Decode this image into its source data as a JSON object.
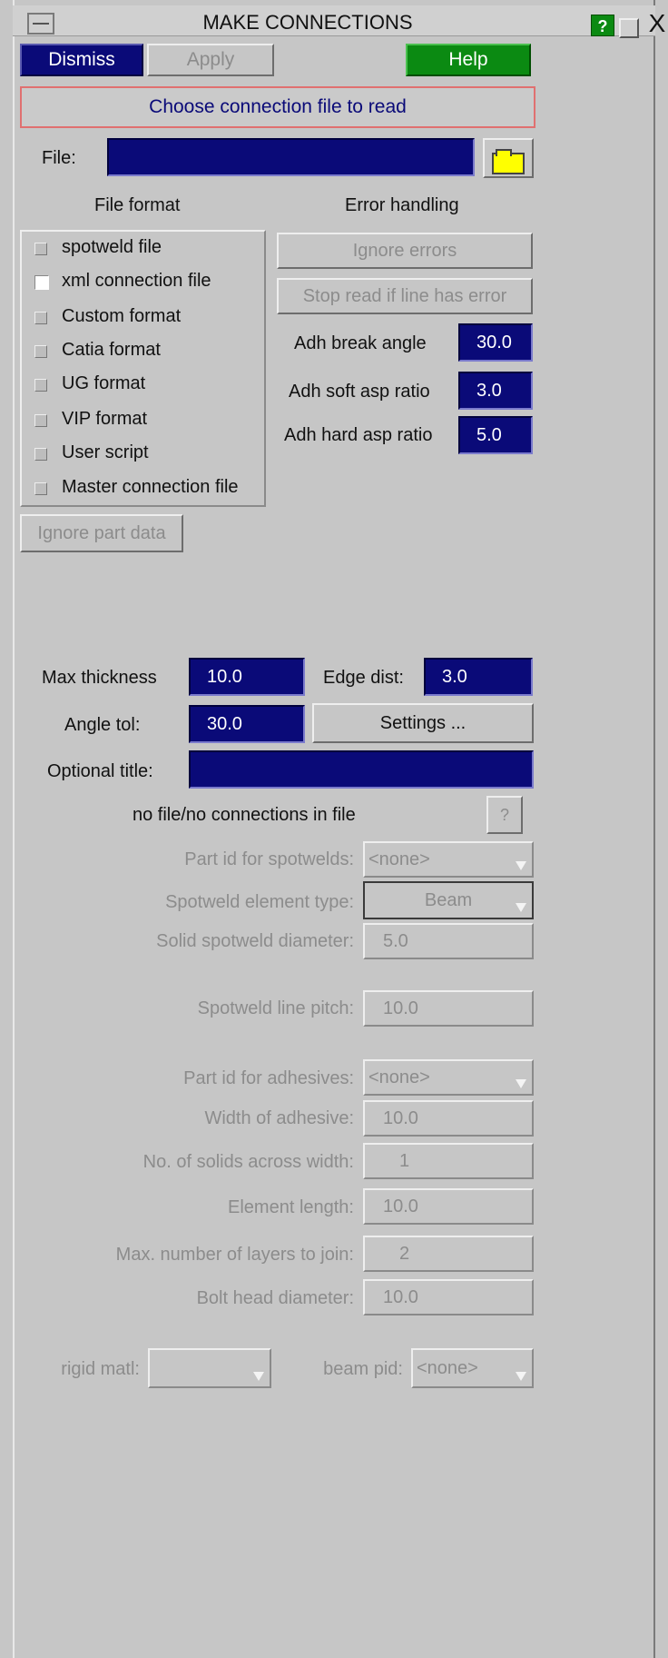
{
  "window": {
    "title": "MAKE CONNECTIONS",
    "help_glyph": "?",
    "close_glyph": "X"
  },
  "toolbar": {
    "dismiss": "Dismiss",
    "apply": "Apply",
    "help": "Help"
  },
  "prompt": "Choose connection file to read",
  "file": {
    "label": "File:",
    "value": ""
  },
  "headers": {
    "file_format": "File format",
    "error_handling": "Error handling"
  },
  "formats": [
    {
      "label": "spotweld file",
      "checked": false
    },
    {
      "label": "xml connection file",
      "checked": true
    },
    {
      "label": "Custom format",
      "checked": false
    },
    {
      "label": "Catia format",
      "checked": false
    },
    {
      "label": "UG format",
      "checked": false
    },
    {
      "label": "VIP format",
      "checked": false
    },
    {
      "label": "User script",
      "checked": false
    },
    {
      "label": "Master connection file",
      "checked": false
    }
  ],
  "error_buttons": {
    "ignore_errors": "Ignore errors",
    "stop_read": "Stop read if line has error"
  },
  "adhesive": {
    "break_angle_label": "Adh break angle",
    "break_angle": "30.0",
    "soft_asp_label": "Adh soft asp ratio",
    "soft_asp": "3.0",
    "hard_asp_label": "Adh hard asp ratio",
    "hard_asp": "5.0"
  },
  "ignore_part_data": "Ignore part data",
  "params": {
    "max_thickness_label": "Max thickness",
    "max_thickness": "10.0",
    "edge_dist_label": "Edge dist:",
    "edge_dist": "3.0",
    "angle_tol_label": "Angle tol:",
    "angle_tol": "30.0",
    "settings": "Settings ...",
    "optional_title_label": "Optional title:",
    "optional_title": ""
  },
  "status": {
    "text": "no file/no connections in file",
    "help_glyph": "?"
  },
  "spot": {
    "part_id_label": "Part id for spotwelds:",
    "part_id": "<none>",
    "elem_type_label": "Spotweld element type:",
    "elem_type": "Beam",
    "solid_diam_label": "Solid spotweld diameter:",
    "solid_diam": "5.0",
    "line_pitch_label": "Spotweld line pitch:",
    "line_pitch": "10.0"
  },
  "adh": {
    "part_id_label": "Part id for adhesives:",
    "part_id": "<none>",
    "width_label": "Width of adhesive:",
    "width": "10.0",
    "solids_label": "No. of solids across width:",
    "solids": "1",
    "elem_len_label": "Element length:",
    "elem_len": "10.0",
    "layers_label": "Max. number of layers to join:",
    "layers": "2",
    "bolt_label": "Bolt head diameter:",
    "bolt": "10.0"
  },
  "bottom": {
    "rigid_matl_label": "rigid matl:",
    "rigid_matl": "",
    "beam_pid_label": "beam pid:",
    "beam_pid": "<none>"
  }
}
